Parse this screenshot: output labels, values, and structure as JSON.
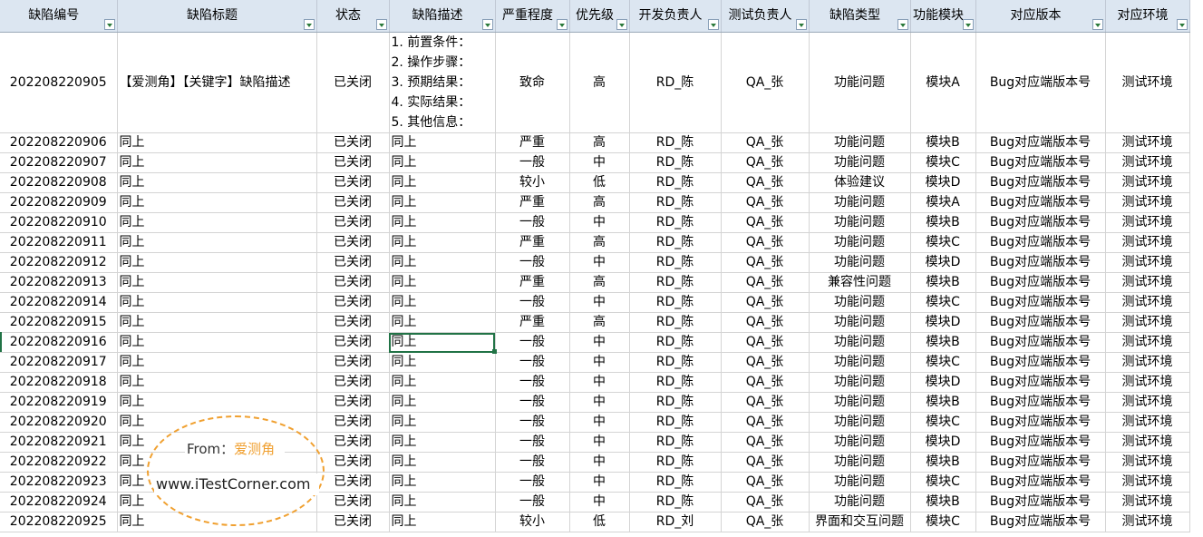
{
  "headers": [
    "缺陷编号",
    "缺陷标题",
    "状态",
    "缺陷描述",
    "严重程度",
    "优先级",
    "开发负责人",
    "测试负责人",
    "缺陷类型",
    "功能模块",
    "对应版本",
    "对应环境"
  ],
  "first_row": {
    "id": "202208220905",
    "title": "【爱测角】【关键字】缺陷描述",
    "status": "已关闭",
    "desc_lines": [
      "1. 前置条件：",
      "2. 操作步骤：",
      "3. 预期结果：",
      "4. 实际结果：",
      "5. 其他信息："
    ],
    "severity": "致命",
    "priority": "高",
    "dev": "RD_陈",
    "qa": "QA_张",
    "type": "功能问题",
    "module": "模块A",
    "version": "Bug对应端版本号",
    "env": "测试环境"
  },
  "rows": [
    [
      "202208220906",
      "同上",
      "已关闭",
      "同上",
      "严重",
      "高",
      "RD_陈",
      "QA_张",
      "功能问题",
      "模块B",
      "Bug对应端版本号",
      "测试环境"
    ],
    [
      "202208220907",
      "同上",
      "已关闭",
      "同上",
      "一般",
      "中",
      "RD_陈",
      "QA_张",
      "功能问题",
      "模块C",
      "Bug对应端版本号",
      "测试环境"
    ],
    [
      "202208220908",
      "同上",
      "已关闭",
      "同上",
      "较小",
      "低",
      "RD_陈",
      "QA_张",
      "体验建议",
      "模块D",
      "Bug对应端版本号",
      "测试环境"
    ],
    [
      "202208220909",
      "同上",
      "已关闭",
      "同上",
      "严重",
      "高",
      "RD_陈",
      "QA_张",
      "功能问题",
      "模块A",
      "Bug对应端版本号",
      "测试环境"
    ],
    [
      "202208220910",
      "同上",
      "已关闭",
      "同上",
      "一般",
      "中",
      "RD_陈",
      "QA_张",
      "功能问题",
      "模块B",
      "Bug对应端版本号",
      "测试环境"
    ],
    [
      "202208220911",
      "同上",
      "已关闭",
      "同上",
      "严重",
      "高",
      "RD_陈",
      "QA_张",
      "功能问题",
      "模块C",
      "Bug对应端版本号",
      "测试环境"
    ],
    [
      "202208220912",
      "同上",
      "已关闭",
      "同上",
      "一般",
      "中",
      "RD_陈",
      "QA_张",
      "功能问题",
      "模块D",
      "Bug对应端版本号",
      "测试环境"
    ],
    [
      "202208220913",
      "同上",
      "已关闭",
      "同上",
      "严重",
      "高",
      "RD_陈",
      "QA_张",
      "兼容性问题",
      "模块B",
      "Bug对应端版本号",
      "测试环境"
    ],
    [
      "202208220914",
      "同上",
      "已关闭",
      "同上",
      "一般",
      "中",
      "RD_陈",
      "QA_张",
      "功能问题",
      "模块C",
      "Bug对应端版本号",
      "测试环境"
    ],
    [
      "202208220915",
      "同上",
      "已关闭",
      "同上",
      "严重",
      "高",
      "RD_陈",
      "QA_张",
      "功能问题",
      "模块D",
      "Bug对应端版本号",
      "测试环境"
    ],
    [
      "202208220916",
      "同上",
      "已关闭",
      "同上",
      "一般",
      "中",
      "RD_陈",
      "QA_张",
      "功能问题",
      "模块B",
      "Bug对应端版本号",
      "测试环境"
    ],
    [
      "202208220917",
      "同上",
      "已关闭",
      "同上",
      "一般",
      "中",
      "RD_陈",
      "QA_张",
      "功能问题",
      "模块C",
      "Bug对应端版本号",
      "测试环境"
    ],
    [
      "202208220918",
      "同上",
      "已关闭",
      "同上",
      "一般",
      "中",
      "RD_陈",
      "QA_张",
      "功能问题",
      "模块D",
      "Bug对应端版本号",
      "测试环境"
    ],
    [
      "202208220919",
      "同上",
      "已关闭",
      "同上",
      "一般",
      "中",
      "RD_陈",
      "QA_张",
      "功能问题",
      "模块B",
      "Bug对应端版本号",
      "测试环境"
    ],
    [
      "202208220920",
      "同上",
      "已关闭",
      "同上",
      "一般",
      "中",
      "RD_陈",
      "QA_张",
      "功能问题",
      "模块C",
      "Bug对应端版本号",
      "测试环境"
    ],
    [
      "202208220921",
      "同上",
      "已关闭",
      "同上",
      "一般",
      "中",
      "RD_陈",
      "QA_张",
      "功能问题",
      "模块D",
      "Bug对应端版本号",
      "测试环境"
    ],
    [
      "202208220922",
      "同上",
      "已关闭",
      "同上",
      "一般",
      "中",
      "RD_陈",
      "QA_张",
      "功能问题",
      "模块B",
      "Bug对应端版本号",
      "测试环境"
    ],
    [
      "202208220923",
      "同上",
      "已关闭",
      "同上",
      "一般",
      "中",
      "RD_陈",
      "QA_张",
      "功能问题",
      "模块C",
      "Bug对应端版本号",
      "测试环境"
    ],
    [
      "202208220924",
      "同上",
      "已关闭",
      "同上",
      "一般",
      "中",
      "RD_陈",
      "QA_张",
      "功能问题",
      "模块B",
      "Bug对应端版本号",
      "测试环境"
    ],
    [
      "202208220925",
      "同上",
      "已关闭",
      "同上",
      "较小",
      "低",
      "RD_刘",
      "QA_张",
      "界面和交互问题",
      "模块C",
      "Bug对应端版本号",
      "测试环境"
    ]
  ],
  "selected_row_index": 10,
  "watermark": {
    "from_label": "From：",
    "brand": "爱测角",
    "url": "www.iTestCorner.com"
  },
  "colors": {
    "header_bg": "#dce6f1",
    "selection": "#217346",
    "watermark": "#f0a030"
  }
}
